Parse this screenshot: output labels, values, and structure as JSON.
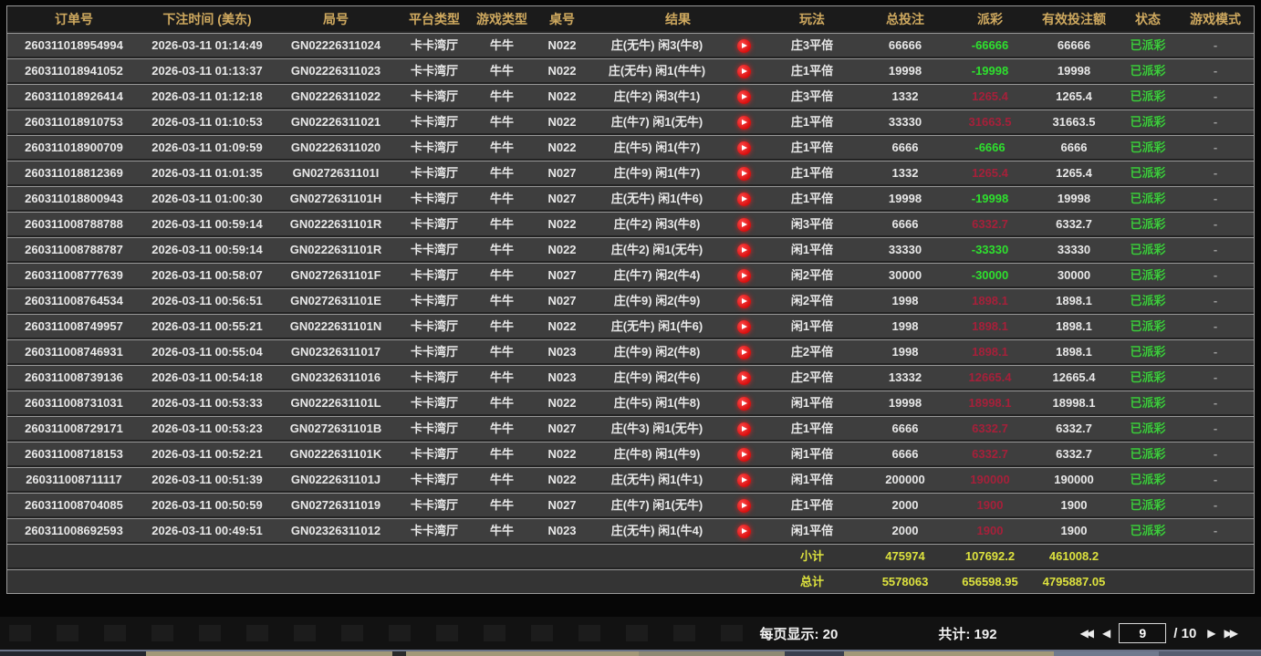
{
  "table": {
    "columns": [
      "订单号",
      "下注时间 (美东)",
      "局号",
      "平台类型",
      "游戏类型",
      "桌号",
      "结果",
      "玩法",
      "总投注",
      "派彩",
      "有效投注额",
      "状态",
      "游戏模式"
    ],
    "rows": [
      {
        "order": "260311018954994",
        "time": "2026-03-11 01:14:49",
        "round": "GN02226311024",
        "platform": "卡卡湾厅",
        "game": "牛牛",
        "table_no": "N022",
        "result": "庄(无牛) 闲3(牛8)",
        "play": "庄3平倍",
        "total_bet": "66666",
        "payout": "-66666",
        "payout_color": "green",
        "valid_bet": "66666",
        "status": "已派彩",
        "mode": "-"
      },
      {
        "order": "260311018941052",
        "time": "2026-03-11 01:13:37",
        "round": "GN02226311023",
        "platform": "卡卡湾厅",
        "game": "牛牛",
        "table_no": "N022",
        "result": "庄(无牛) 闲1(牛牛)",
        "play": "庄1平倍",
        "total_bet": "19998",
        "payout": "-19998",
        "payout_color": "green",
        "valid_bet": "19998",
        "status": "已派彩",
        "mode": "-"
      },
      {
        "order": "260311018926414",
        "time": "2026-03-11 01:12:18",
        "round": "GN02226311022",
        "platform": "卡卡湾厅",
        "game": "牛牛",
        "table_no": "N022",
        "result": "庄(牛2) 闲3(牛1)",
        "play": "庄3平倍",
        "total_bet": "1332",
        "payout": "1265.4",
        "payout_color": "red",
        "valid_bet": "1265.4",
        "status": "已派彩",
        "mode": "-"
      },
      {
        "order": "260311018910753",
        "time": "2026-03-11 01:10:53",
        "round": "GN02226311021",
        "platform": "卡卡湾厅",
        "game": "牛牛",
        "table_no": "N022",
        "result": "庄(牛7) 闲1(无牛)",
        "play": "庄1平倍",
        "total_bet": "33330",
        "payout": "31663.5",
        "payout_color": "red",
        "valid_bet": "31663.5",
        "status": "已派彩",
        "mode": "-"
      },
      {
        "order": "260311018900709",
        "time": "2026-03-11 01:09:59",
        "round": "GN02226311020",
        "platform": "卡卡湾厅",
        "game": "牛牛",
        "table_no": "N022",
        "result": "庄(牛5) 闲1(牛7)",
        "play": "庄1平倍",
        "total_bet": "6666",
        "payout": "-6666",
        "payout_color": "green",
        "valid_bet": "6666",
        "status": "已派彩",
        "mode": "-"
      },
      {
        "order": "260311018812369",
        "time": "2026-03-11 01:01:35",
        "round": "GN0272631101I",
        "platform": "卡卡湾厅",
        "game": "牛牛",
        "table_no": "N027",
        "result": "庄(牛9) 闲1(牛7)",
        "play": "庄1平倍",
        "total_bet": "1332",
        "payout": "1265.4",
        "payout_color": "red",
        "valid_bet": "1265.4",
        "status": "已派彩",
        "mode": "-"
      },
      {
        "order": "260311018800943",
        "time": "2026-03-11 01:00:30",
        "round": "GN0272631101H",
        "platform": "卡卡湾厅",
        "game": "牛牛",
        "table_no": "N027",
        "result": "庄(无牛) 闲1(牛6)",
        "play": "庄1平倍",
        "total_bet": "19998",
        "payout": "-19998",
        "payout_color": "green",
        "valid_bet": "19998",
        "status": "已派彩",
        "mode": "-"
      },
      {
        "order": "260311008788788",
        "time": "2026-03-11 00:59:14",
        "round": "GN0222631101R",
        "platform": "卡卡湾厅",
        "game": "牛牛",
        "table_no": "N022",
        "result": "庄(牛2) 闲3(牛8)",
        "play": "闲3平倍",
        "total_bet": "6666",
        "payout": "6332.7",
        "payout_color": "red",
        "valid_bet": "6332.7",
        "status": "已派彩",
        "mode": "-"
      },
      {
        "order": "260311008788787",
        "time": "2026-03-11 00:59:14",
        "round": "GN0222631101R",
        "platform": "卡卡湾厅",
        "game": "牛牛",
        "table_no": "N022",
        "result": "庄(牛2) 闲1(无牛)",
        "play": "闲1平倍",
        "total_bet": "33330",
        "payout": "-33330",
        "payout_color": "green",
        "valid_bet": "33330",
        "status": "已派彩",
        "mode": "-"
      },
      {
        "order": "260311008777639",
        "time": "2026-03-11 00:58:07",
        "round": "GN0272631101F",
        "platform": "卡卡湾厅",
        "game": "牛牛",
        "table_no": "N027",
        "result": "庄(牛7) 闲2(牛4)",
        "play": "闲2平倍",
        "total_bet": "30000",
        "payout": "-30000",
        "payout_color": "green",
        "valid_bet": "30000",
        "status": "已派彩",
        "mode": "-"
      },
      {
        "order": "260311008764534",
        "time": "2026-03-11 00:56:51",
        "round": "GN0272631101E",
        "platform": "卡卡湾厅",
        "game": "牛牛",
        "table_no": "N027",
        "result": "庄(牛9) 闲2(牛9)",
        "play": "闲2平倍",
        "total_bet": "1998",
        "payout": "1898.1",
        "payout_color": "red",
        "valid_bet": "1898.1",
        "status": "已派彩",
        "mode": "-"
      },
      {
        "order": "260311008749957",
        "time": "2026-03-11 00:55:21",
        "round": "GN0222631101N",
        "platform": "卡卡湾厅",
        "game": "牛牛",
        "table_no": "N022",
        "result": "庄(无牛) 闲1(牛6)",
        "play": "闲1平倍",
        "total_bet": "1998",
        "payout": "1898.1",
        "payout_color": "red",
        "valid_bet": "1898.1",
        "status": "已派彩",
        "mode": "-"
      },
      {
        "order": "260311008746931",
        "time": "2026-03-11 00:55:04",
        "round": "GN02326311017",
        "platform": "卡卡湾厅",
        "game": "牛牛",
        "table_no": "N023",
        "result": "庄(牛9) 闲2(牛8)",
        "play": "庄2平倍",
        "total_bet": "1998",
        "payout": "1898.1",
        "payout_color": "red",
        "valid_bet": "1898.1",
        "status": "已派彩",
        "mode": "-"
      },
      {
        "order": "260311008739136",
        "time": "2026-03-11 00:54:18",
        "round": "GN02326311016",
        "platform": "卡卡湾厅",
        "game": "牛牛",
        "table_no": "N023",
        "result": "庄(牛9) 闲2(牛6)",
        "play": "庄2平倍",
        "total_bet": "13332",
        "payout": "12665.4",
        "payout_color": "red",
        "valid_bet": "12665.4",
        "status": "已派彩",
        "mode": "-"
      },
      {
        "order": "260311008731031",
        "time": "2026-03-11 00:53:33",
        "round": "GN0222631101L",
        "platform": "卡卡湾厅",
        "game": "牛牛",
        "table_no": "N022",
        "result": "庄(牛5) 闲1(牛8)",
        "play": "闲1平倍",
        "total_bet": "19998",
        "payout": "18998.1",
        "payout_color": "red",
        "valid_bet": "18998.1",
        "status": "已派彩",
        "mode": "-"
      },
      {
        "order": "260311008729171",
        "time": "2026-03-11 00:53:23",
        "round": "GN0272631101B",
        "platform": "卡卡湾厅",
        "game": "牛牛",
        "table_no": "N027",
        "result": "庄(牛3) 闲1(无牛)",
        "play": "庄1平倍",
        "total_bet": "6666",
        "payout": "6332.7",
        "payout_color": "red",
        "valid_bet": "6332.7",
        "status": "已派彩",
        "mode": "-"
      },
      {
        "order": "260311008718153",
        "time": "2026-03-11 00:52:21",
        "round": "GN0222631101K",
        "platform": "卡卡湾厅",
        "game": "牛牛",
        "table_no": "N022",
        "result": "庄(牛8) 闲1(牛9)",
        "play": "闲1平倍",
        "total_bet": "6666",
        "payout": "6332.7",
        "payout_color": "red",
        "valid_bet": "6332.7",
        "status": "已派彩",
        "mode": "-"
      },
      {
        "order": "260311008711117",
        "time": "2026-03-11 00:51:39",
        "round": "GN0222631101J",
        "platform": "卡卡湾厅",
        "game": "牛牛",
        "table_no": "N022",
        "result": "庄(无牛) 闲1(牛1)",
        "play": "闲1平倍",
        "total_bet": "200000",
        "payout": "190000",
        "payout_color": "red",
        "valid_bet": "190000",
        "status": "已派彩",
        "mode": "-"
      },
      {
        "order": "260311008704085",
        "time": "2026-03-11 00:50:59",
        "round": "GN02726311019",
        "platform": "卡卡湾厅",
        "game": "牛牛",
        "table_no": "N027",
        "result": "庄(牛7) 闲1(无牛)",
        "play": "庄1平倍",
        "total_bet": "2000",
        "payout": "1900",
        "payout_color": "red",
        "valid_bet": "1900",
        "status": "已派彩",
        "mode": "-"
      },
      {
        "order": "260311008692593",
        "time": "2026-03-11 00:49:51",
        "round": "GN02326311012",
        "platform": "卡卡湾厅",
        "game": "牛牛",
        "table_no": "N023",
        "result": "庄(无牛) 闲1(牛4)",
        "play": "闲1平倍",
        "total_bet": "2000",
        "payout": "1900",
        "payout_color": "red",
        "valid_bet": "1900",
        "status": "已派彩",
        "mode": "-"
      }
    ],
    "subtotal": {
      "label": "小计",
      "total_bet": "475974",
      "payout": "107692.2",
      "valid_bet": "461008.2"
    },
    "grand_total": {
      "label": "总计",
      "total_bet": "5578063",
      "payout": "656598.95",
      "valid_bet": "4795887.05"
    }
  },
  "footer": {
    "per_page_label": "每页显示: 20",
    "total_label": "共计: 192",
    "page_input": "9",
    "page_total": "/ 10",
    "icons": {
      "first": "◀◀",
      "prev": "◀",
      "next": "▶",
      "last": "▶▶"
    }
  },
  "colors": {
    "header_text": "#cfa95f",
    "positive_payout": "#a6203a",
    "negative_payout": "#2ee02e",
    "status_paid": "#3fca3f",
    "summary_yellow": "#dde23e",
    "play_button": "#d80e0e"
  }
}
